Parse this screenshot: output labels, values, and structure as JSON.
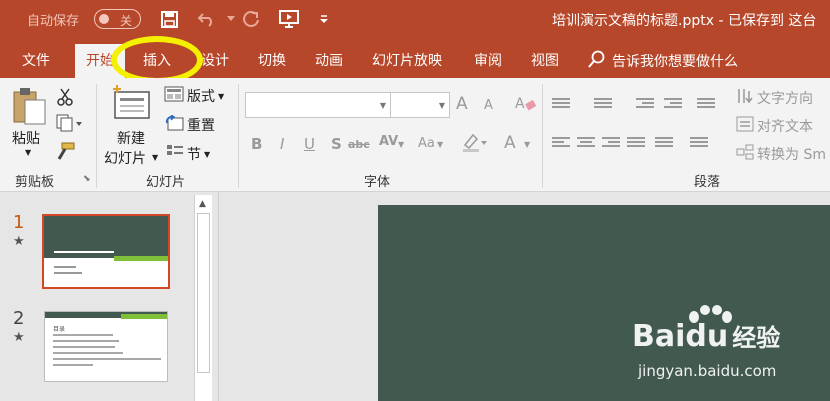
{
  "titlebar": {
    "autosave_label": "自动保存",
    "autosave_state": "关",
    "document_title": "培训演示文稿的标题.pptx - 已保存到 这台"
  },
  "tabs": {
    "file": "文件",
    "home": "开始",
    "insert": "插入",
    "design": "设计",
    "transitions": "切换",
    "animations": "动画",
    "slideshow": "幻灯片放映",
    "review": "审阅",
    "view": "视图",
    "tell_me": "告诉我你想要做什么"
  },
  "ribbon": {
    "clipboard": {
      "paste": "粘贴",
      "group_label": "剪贴板"
    },
    "slides": {
      "new_slide_line1": "新建",
      "new_slide_line2": "幻灯片",
      "layout": "版式",
      "reset": "重置",
      "section": "节",
      "group_label": "幻灯片"
    },
    "font": {
      "group_label": "字体",
      "bold": "B",
      "italic": "I",
      "underline": "U",
      "strike": "S",
      "shadow": "abc",
      "spacing": "AV",
      "case": "Aa",
      "grow": "A",
      "shrink": "A",
      "color": "A"
    },
    "paragraph": {
      "group_label": "段落",
      "text_direction": "文字方向",
      "align_text": "对齐文本",
      "convert_smartart": "转换为 Sm"
    }
  },
  "slides_pane": {
    "slide1_number": "1",
    "slide2_number": "2",
    "slide2_title": "目录"
  },
  "watermark": {
    "brand_left": "Bai",
    "brand_mid": "du",
    "brand_right": "经验",
    "url": "jingyan.baidu.com"
  },
  "colors": {
    "accent": "#b7472a",
    "slide_bg": "#41594e",
    "highlight": "#f5f000",
    "stripe_green": "#7fbf3a"
  }
}
